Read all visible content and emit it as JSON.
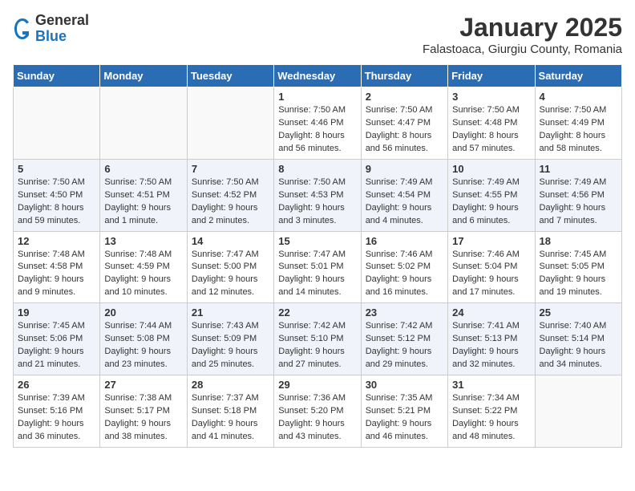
{
  "header": {
    "logo_general": "General",
    "logo_blue": "Blue",
    "month_title": "January 2025",
    "subtitle": "Falastoaca, Giurgiu County, Romania"
  },
  "calendar": {
    "days_of_week": [
      "Sunday",
      "Monday",
      "Tuesday",
      "Wednesday",
      "Thursday",
      "Friday",
      "Saturday"
    ],
    "weeks": [
      [
        {
          "day": "",
          "info": ""
        },
        {
          "day": "",
          "info": ""
        },
        {
          "day": "",
          "info": ""
        },
        {
          "day": "1",
          "info": "Sunrise: 7:50 AM\nSunset: 4:46 PM\nDaylight: 8 hours\nand 56 minutes."
        },
        {
          "day": "2",
          "info": "Sunrise: 7:50 AM\nSunset: 4:47 PM\nDaylight: 8 hours\nand 56 minutes."
        },
        {
          "day": "3",
          "info": "Sunrise: 7:50 AM\nSunset: 4:48 PM\nDaylight: 8 hours\nand 57 minutes."
        },
        {
          "day": "4",
          "info": "Sunrise: 7:50 AM\nSunset: 4:49 PM\nDaylight: 8 hours\nand 58 minutes."
        }
      ],
      [
        {
          "day": "5",
          "info": "Sunrise: 7:50 AM\nSunset: 4:50 PM\nDaylight: 8 hours\nand 59 minutes."
        },
        {
          "day": "6",
          "info": "Sunrise: 7:50 AM\nSunset: 4:51 PM\nDaylight: 9 hours\nand 1 minute."
        },
        {
          "day": "7",
          "info": "Sunrise: 7:50 AM\nSunset: 4:52 PM\nDaylight: 9 hours\nand 2 minutes."
        },
        {
          "day": "8",
          "info": "Sunrise: 7:50 AM\nSunset: 4:53 PM\nDaylight: 9 hours\nand 3 minutes."
        },
        {
          "day": "9",
          "info": "Sunrise: 7:49 AM\nSunset: 4:54 PM\nDaylight: 9 hours\nand 4 minutes."
        },
        {
          "day": "10",
          "info": "Sunrise: 7:49 AM\nSunset: 4:55 PM\nDaylight: 9 hours\nand 6 minutes."
        },
        {
          "day": "11",
          "info": "Sunrise: 7:49 AM\nSunset: 4:56 PM\nDaylight: 9 hours\nand 7 minutes."
        }
      ],
      [
        {
          "day": "12",
          "info": "Sunrise: 7:48 AM\nSunset: 4:58 PM\nDaylight: 9 hours\nand 9 minutes."
        },
        {
          "day": "13",
          "info": "Sunrise: 7:48 AM\nSunset: 4:59 PM\nDaylight: 9 hours\nand 10 minutes."
        },
        {
          "day": "14",
          "info": "Sunrise: 7:47 AM\nSunset: 5:00 PM\nDaylight: 9 hours\nand 12 minutes."
        },
        {
          "day": "15",
          "info": "Sunrise: 7:47 AM\nSunset: 5:01 PM\nDaylight: 9 hours\nand 14 minutes."
        },
        {
          "day": "16",
          "info": "Sunrise: 7:46 AM\nSunset: 5:02 PM\nDaylight: 9 hours\nand 16 minutes."
        },
        {
          "day": "17",
          "info": "Sunrise: 7:46 AM\nSunset: 5:04 PM\nDaylight: 9 hours\nand 17 minutes."
        },
        {
          "day": "18",
          "info": "Sunrise: 7:45 AM\nSunset: 5:05 PM\nDaylight: 9 hours\nand 19 minutes."
        }
      ],
      [
        {
          "day": "19",
          "info": "Sunrise: 7:45 AM\nSunset: 5:06 PM\nDaylight: 9 hours\nand 21 minutes."
        },
        {
          "day": "20",
          "info": "Sunrise: 7:44 AM\nSunset: 5:08 PM\nDaylight: 9 hours\nand 23 minutes."
        },
        {
          "day": "21",
          "info": "Sunrise: 7:43 AM\nSunset: 5:09 PM\nDaylight: 9 hours\nand 25 minutes."
        },
        {
          "day": "22",
          "info": "Sunrise: 7:42 AM\nSunset: 5:10 PM\nDaylight: 9 hours\nand 27 minutes."
        },
        {
          "day": "23",
          "info": "Sunrise: 7:42 AM\nSunset: 5:12 PM\nDaylight: 9 hours\nand 29 minutes."
        },
        {
          "day": "24",
          "info": "Sunrise: 7:41 AM\nSunset: 5:13 PM\nDaylight: 9 hours\nand 32 minutes."
        },
        {
          "day": "25",
          "info": "Sunrise: 7:40 AM\nSunset: 5:14 PM\nDaylight: 9 hours\nand 34 minutes."
        }
      ],
      [
        {
          "day": "26",
          "info": "Sunrise: 7:39 AM\nSunset: 5:16 PM\nDaylight: 9 hours\nand 36 minutes."
        },
        {
          "day": "27",
          "info": "Sunrise: 7:38 AM\nSunset: 5:17 PM\nDaylight: 9 hours\nand 38 minutes."
        },
        {
          "day": "28",
          "info": "Sunrise: 7:37 AM\nSunset: 5:18 PM\nDaylight: 9 hours\nand 41 minutes."
        },
        {
          "day": "29",
          "info": "Sunrise: 7:36 AM\nSunset: 5:20 PM\nDaylight: 9 hours\nand 43 minutes."
        },
        {
          "day": "30",
          "info": "Sunrise: 7:35 AM\nSunset: 5:21 PM\nDaylight: 9 hours\nand 46 minutes."
        },
        {
          "day": "31",
          "info": "Sunrise: 7:34 AM\nSunset: 5:22 PM\nDaylight: 9 hours\nand 48 minutes."
        },
        {
          "day": "",
          "info": ""
        }
      ]
    ]
  }
}
